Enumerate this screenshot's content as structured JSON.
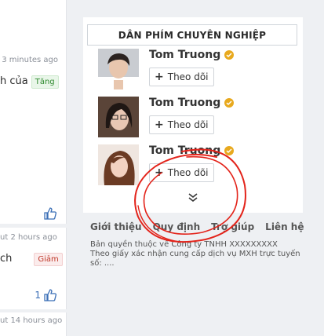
{
  "feed": {
    "items": [
      {
        "time": "3 minutes ago",
        "snippet": "h của",
        "tag": "Tăng",
        "tag_type": "up",
        "likes": ""
      },
      {
        "meta": "ut 2 hours ago",
        "snippet": "ch",
        "tag": "Giảm",
        "tag_type": "down",
        "likes": "1"
      },
      {
        "meta": "ut 14 hours ago"
      }
    ]
  },
  "widget": {
    "title": "DÂN PHÍM CHUYÊN NGHIỆP",
    "users": [
      {
        "name": "Tom Truong",
        "follow_label": "Theo dõi"
      },
      {
        "name": "Tom Truong",
        "follow_label": "Theo dõi"
      },
      {
        "name": "Tom Truong",
        "follow_label": "Theo dõi"
      }
    ]
  },
  "footer": {
    "links": [
      "Giới thiệu",
      "Quy định",
      "Trợ giúp",
      "Liên hệ"
    ],
    "copyright": "Bản quyền thuộc về Công ty TNHH XXXXXXXXX",
    "license": "Theo giấy xác nhận cung cấp dịch vụ MXH trực tuyến số: ...."
  },
  "colors": {
    "tag_up": "#2f8a2f",
    "tag_down": "#c0392b",
    "verified": "#e8a91e",
    "annotation": "#e3241b",
    "link": "#3b6fb6"
  }
}
